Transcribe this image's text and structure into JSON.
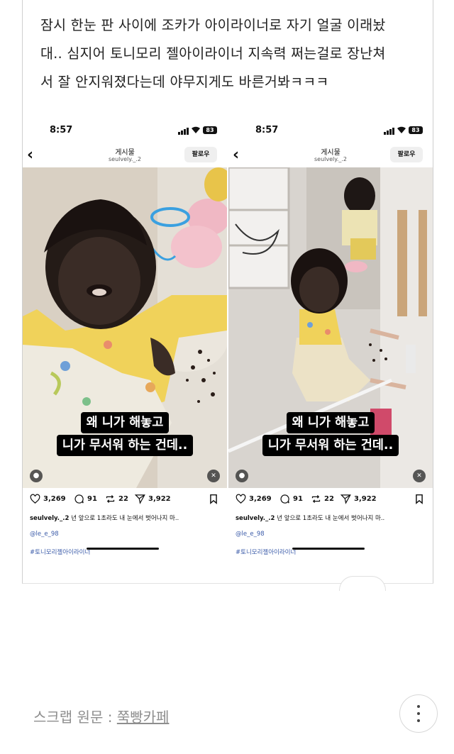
{
  "post": {
    "text": "잠시 한눈 판 사이에 조카가 아이라이너로 자기 얼굴 이래놨\n대.. 심지어 토니모리 젤아이라이너 지속력 쩌는걸로 장난쳐\n서 잘 안지워졌다는데 야무지게도 바른거봐ㅋㅋㅋ"
  },
  "screenshots": [
    {
      "status": {
        "time": "8:57",
        "battery": "83"
      },
      "header": {
        "title": "게시물",
        "username": "seulvely._.2",
        "follow_label": "팔로우"
      },
      "caption": {
        "line1": "왜 니가 해놓고",
        "line2": "니가 무서워 하는 건데.."
      },
      "actions": {
        "likes": "3,269",
        "comments": "91",
        "reposts": "22",
        "shares": "3,922"
      },
      "description": {
        "user": "seulvely._.2",
        "text": "년 앞으로 1초라도 내 눈에서 벗어나지 마.."
      },
      "mention": "@le_e_98",
      "hashtag": "#토니모리젤아이라이너"
    },
    {
      "status": {
        "time": "8:57",
        "battery": "83"
      },
      "header": {
        "title": "게시물",
        "username": "seulvely._.2",
        "follow_label": "팔로우"
      },
      "caption": {
        "line1": "왜 니가 해놓고",
        "line2": "니가 무서워 하는 건데.."
      },
      "actions": {
        "likes": "3,269",
        "comments": "91",
        "reposts": "22",
        "shares": "3,922"
      },
      "description": {
        "user": "seulvely._.2",
        "text": "년 앞으로 1초라도 내 눈에서 벗어나지 마.."
      },
      "mention": "@le_e_98",
      "hashtag": "#토니모리젤아이라이너"
    }
  ],
  "footer": {
    "source_prefix": "스크랩 원문 : ",
    "source_link": "쭉빵카페"
  },
  "colors": {
    "caption_bg": "#000000",
    "link_blue": "#3b5ba9",
    "source_gray": "#8e8e8e"
  },
  "icons": [
    "back-chevron-icon",
    "heart-icon",
    "comment-icon",
    "repost-icon",
    "send-icon",
    "bookmark-icon",
    "person-icon",
    "mute-icon",
    "more-vertical-icon"
  ]
}
